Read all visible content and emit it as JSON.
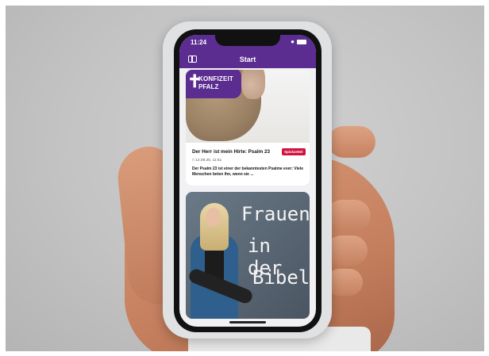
{
  "status_bar": {
    "time": "11:24"
  },
  "header": {
    "title": "Start"
  },
  "cards": [
    {
      "logo_line1": "KONFIZEIT",
      "logo_line2": "PFALZ",
      "title": "Der Herr ist mein Hirte: Psalm 23",
      "tag": "Spickzettel",
      "date": "12.09.25, 11:51",
      "excerpt": "Der Psalm 23 ist einer der bekanntesten Psalme ever: Viele Menschen beten ihn, wenn sie ..."
    },
    {
      "image_text_line1": "Frauen",
      "image_text_line2": "in der",
      "image_text_line3": "Bibel"
    }
  ],
  "colors": {
    "brand": "#5b2d91",
    "tag": "#d0123e"
  }
}
